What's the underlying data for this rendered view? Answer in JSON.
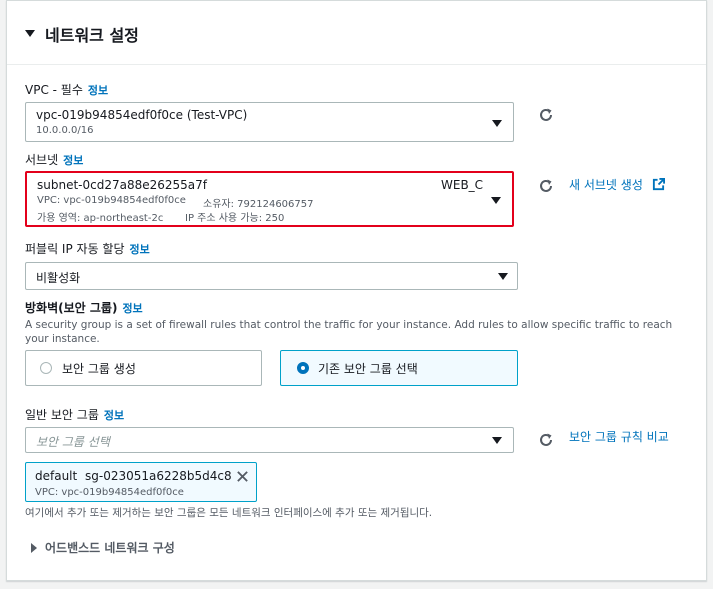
{
  "panel": {
    "title": "네트워크 설정"
  },
  "vpc": {
    "label": "VPC - 필수",
    "info": "정보",
    "value": "vpc-019b94854edf0f0ce (Test-VPC)",
    "cidr": "10.0.0.0/16"
  },
  "subnet": {
    "label": "서브넷",
    "info": "정보",
    "id": "subnet-0cd27a88e26255a7f",
    "name": "WEB_C",
    "vpc": "VPC: vpc-019b94854edf0f0ce",
    "owner": "소유자: 792124606757",
    "az": "가용 영역: ap-northeast-2c",
    "ips": "IP 주소 사용 가능: 250",
    "create_link": "새 서브넷 생성",
    "highlight_color": "#e3001b"
  },
  "public_ip": {
    "label": "퍼블릭 IP 자동 할당",
    "info": "정보",
    "value": "비활성화"
  },
  "firewall": {
    "label": "방화벽(보안 그룹)",
    "info": "정보",
    "description": "A security group is a set of firewall rules that control the traffic for your instance. Add rules to allow specific traffic to reach your instance.",
    "option_create": "보안 그룹 생성",
    "option_existing": "기존 보안 그룹 선택",
    "selected": "existing"
  },
  "common_sg": {
    "label": "일반 보안 그룹",
    "info": "정보",
    "placeholder": "보안 그룹 선택",
    "compare_link": "보안 그룹 규칙 비교",
    "token_name": "default",
    "token_id": "sg-023051a6228b5d4c8",
    "token_vpc": "VPC: vpc-019b94854edf0f0ce",
    "note": "여기에서 추가 또는 제거하는 보안 그룹은 모든 네트워크 인터페이스에 추가 또는 제거됩니다."
  },
  "advanced": {
    "label": "어드밴스드 네트워크 구성"
  },
  "colors": {
    "accent": "#0073bb",
    "selected_border": "#00a1c9",
    "border": "#aab7b8"
  }
}
